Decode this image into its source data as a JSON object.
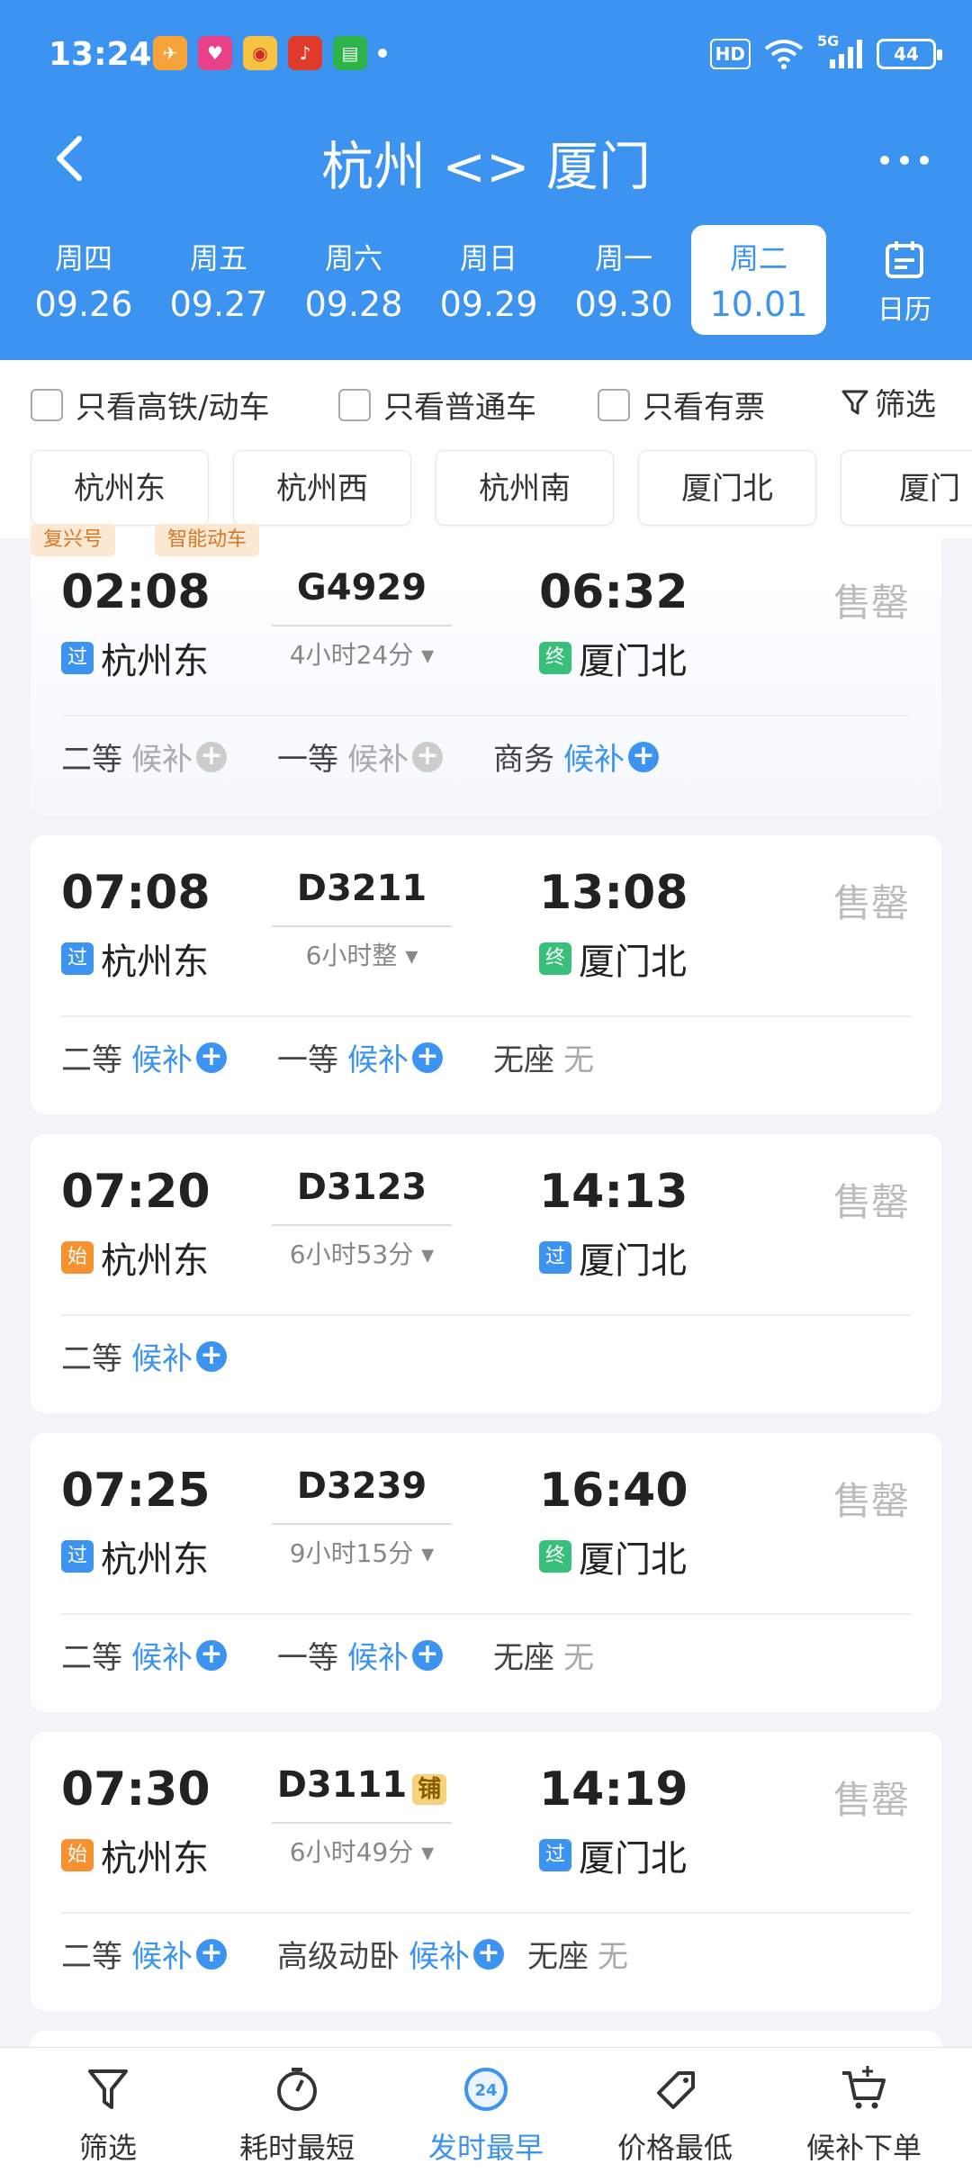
{
  "status": {
    "time": "13:24",
    "hd": "HD",
    "network": "5G",
    "battery": "44"
  },
  "title": "杭州 <> 厦门",
  "dates": [
    {
      "weekday": "周四",
      "date": "09.26"
    },
    {
      "weekday": "周五",
      "date": "09.27"
    },
    {
      "weekday": "周六",
      "date": "09.28"
    },
    {
      "weekday": "周日",
      "date": "09.29"
    },
    {
      "weekday": "周一",
      "date": "09.30"
    },
    {
      "weekday": "周二",
      "date": "10.01",
      "active": true
    }
  ],
  "calendar_label": "日历",
  "filters": {
    "high_speed": "只看高铁/动车",
    "normal": "只看普通车",
    "available": "只看有票",
    "filter": "筛选"
  },
  "stations": [
    "杭州东",
    "杭州西",
    "杭州南",
    "厦门北",
    "厦门"
  ],
  "trains": [
    {
      "tags": [
        "复兴号",
        "智能动车"
      ],
      "dep_time": "02:08",
      "train_no": "G4929",
      "arr_time": "06:32",
      "duration": "4小时24分",
      "status": "售罄",
      "from_badge": "过",
      "from": "杭州东",
      "to_badge": "终",
      "to": "厦门北",
      "seats": [
        {
          "class": "二等",
          "value": "候补",
          "plus": "gray"
        },
        {
          "class": "一等",
          "value": "候补",
          "plus": "gray"
        },
        {
          "class": "商务",
          "value": "候补",
          "plus": "blue"
        }
      ]
    },
    {
      "dep_time": "07:08",
      "train_no": "D3211",
      "arr_time": "13:08",
      "duration": "6小时整",
      "status": "售罄",
      "from_badge": "过",
      "from": "杭州东",
      "to_badge": "终",
      "to": "厦门北",
      "seats": [
        {
          "class": "二等",
          "value": "候补",
          "plus": "blue"
        },
        {
          "class": "一等",
          "value": "候补",
          "plus": "blue"
        },
        {
          "class": "无座",
          "value": "无",
          "plus": "none"
        }
      ]
    },
    {
      "dep_time": "07:20",
      "train_no": "D3123",
      "arr_time": "14:13",
      "duration": "6小时53分",
      "status": "售罄",
      "from_badge": "始",
      "from": "杭州东",
      "to_badge": "过",
      "to": "厦门北",
      "seats": [
        {
          "class": "二等",
          "value": "候补",
          "plus": "blue"
        }
      ]
    },
    {
      "dep_time": "07:25",
      "train_no": "D3239",
      "arr_time": "16:40",
      "duration": "9小时15分",
      "status": "售罄",
      "from_badge": "过",
      "from": "杭州东",
      "to_badge": "终",
      "to": "厦门北",
      "seats": [
        {
          "class": "二等",
          "value": "候补",
          "plus": "blue"
        },
        {
          "class": "一等",
          "value": "候补",
          "plus": "blue"
        },
        {
          "class": "无座",
          "value": "无",
          "plus": "none"
        }
      ]
    },
    {
      "dep_time": "07:30",
      "train_no": "D3111",
      "berth": "铺",
      "arr_time": "14:19",
      "duration": "6小时49分",
      "status": "售罄",
      "from_badge": "始",
      "from": "杭州东",
      "to_badge": "过",
      "to": "厦门北",
      "seats": [
        {
          "class": "二等",
          "value": "候补",
          "plus": "blue"
        },
        {
          "class": "高级动卧",
          "value": "候补",
          "plus": "blue"
        },
        {
          "class": "无座",
          "value": "无",
          "plus": "none"
        }
      ]
    }
  ],
  "bottom_nav": [
    {
      "label": "筛选",
      "icon": "filter-icon"
    },
    {
      "label": "耗时最短",
      "icon": "timer-icon"
    },
    {
      "label": "发时最早",
      "icon": "clock-24-icon",
      "active": true
    },
    {
      "label": "价格最低",
      "icon": "price-tag-icon"
    },
    {
      "label": "候补下单",
      "icon": "cart-add-icon"
    }
  ],
  "colors": {
    "primary": "#3d93f0",
    "sold": "#bbbbbb",
    "through": "#3d93f0",
    "terminal": "#38c07a",
    "origin": "#f5912e"
  }
}
